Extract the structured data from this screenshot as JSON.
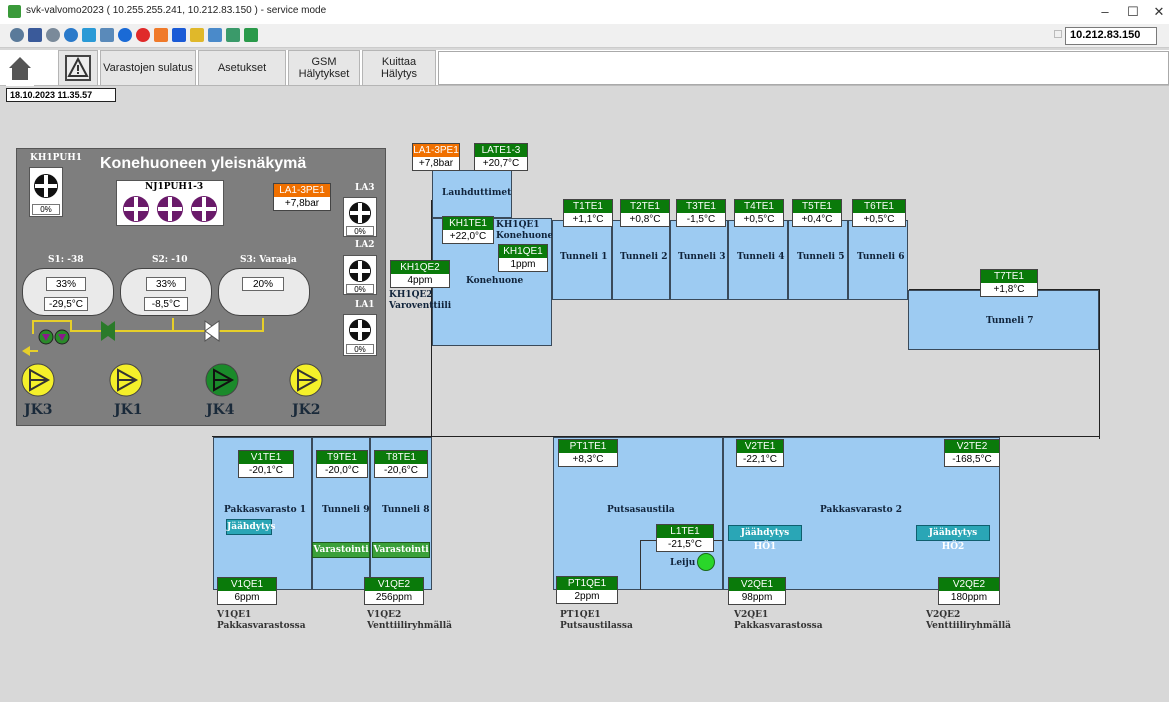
{
  "window": {
    "title": "svk-valvomo2023 ( 10.255.255.241, 10.212.83.150 ) - service mode",
    "ip": "10.212.83.150"
  },
  "nav": {
    "home_icon": "home-icon",
    "alarm_icon": "warning-icon",
    "btn1": "Varastojen sulatus",
    "btn2": "Asetukset",
    "btn3_l1": "GSM",
    "btn3_l2": "Hälytykset",
    "btn4_l1": "Kuittaa",
    "btn4_l2": "Hälytys"
  },
  "datetime": "18.10.2023 11.35.57",
  "machine": {
    "title": "Konehuoneen yleisnäkymä",
    "kh1puh1": "KH1PUH1",
    "kh1puh1_pct": "0%",
    "nj1puh": "NJ1PUH1-3",
    "la1_3pe1_tag": "LA1-3PE1",
    "la1_3pe1_val": "+7,8bar",
    "la3": "LA3",
    "la3_pct": "0%",
    "la2": "LA2",
    "la2_pct": "0%",
    "la1": "LA1",
    "la1_pct": "0%",
    "s1_label": "S1: -38",
    "s2_label": "S2: -10",
    "s3_label": "S3: Varaaja",
    "s1_pct": "33%",
    "s1_temp": "-29,5°C",
    "s2_pct": "33%",
    "s2_temp": "-8,5°C",
    "s3_pct": "20%",
    "jk3": "JK3",
    "jk1": "JK1",
    "jk4": "JK4",
    "jk2": "JK2"
  },
  "tags": {
    "la13pe1": {
      "name": "LA1-3PE1",
      "value": "+7,8bar"
    },
    "late13": {
      "name": "LATE1-3",
      "value": "+20,7°C"
    },
    "kh1te1": {
      "name": "KH1TE1",
      "value": "+22,0°C"
    },
    "kh1qe1": {
      "name": "KH1QE1",
      "value": "1ppm"
    },
    "kh1qe2": {
      "name": "KH1QE2",
      "value": "4ppm"
    },
    "t1te1": {
      "name": "T1TE1",
      "value": "+1,1°C"
    },
    "t2te1": {
      "name": "T2TE1",
      "value": "+0,8°C"
    },
    "t3te1": {
      "name": "T3TE1",
      "value": "-1,5°C"
    },
    "t4te1": {
      "name": "T4TE1",
      "value": "+0,5°C"
    },
    "t5te1": {
      "name": "T5TE1",
      "value": "+0,4°C"
    },
    "t6te1": {
      "name": "T6TE1",
      "value": "+0,5°C"
    },
    "t7te1": {
      "name": "T7TE1",
      "value": "+1,8°C"
    },
    "v1te1": {
      "name": "V1TE1",
      "value": "-20,1°C"
    },
    "t9te1": {
      "name": "T9TE1",
      "value": "-20,0°C"
    },
    "t8te1": {
      "name": "T8TE1",
      "value": "-20,6°C"
    },
    "pt1te1": {
      "name": "PT1TE1",
      "value": "+8,3°C"
    },
    "l1te1": {
      "name": "L1TE1",
      "value": "-21,5°C"
    },
    "v2te1": {
      "name": "V2TE1",
      "value": "-22,1°C"
    },
    "v2te2": {
      "name": "V2TE2",
      "value": "-168,5°C"
    },
    "v1qe1": {
      "name": "V1QE1",
      "value": "6ppm"
    },
    "v1qe2": {
      "name": "V1QE2",
      "value": "256ppm"
    },
    "pt1qe1": {
      "name": "PT1QE1",
      "value": "2ppm"
    },
    "v2qe1": {
      "name": "V2QE1",
      "value": "98ppm"
    },
    "v2qe2": {
      "name": "V2QE2",
      "value": "180ppm"
    }
  },
  "rooms": {
    "lauhduttimet": "Lauhduttimet",
    "konehuone": "Konehuone",
    "kh1qe1_l1": "KH1QE1",
    "kh1qe1_l2": "Konehuone",
    "kh1qe2_l1": "KH1QE2",
    "kh1qe2_l2": "Varoventtiili",
    "t1": "Tunneli 1",
    "t2": "Tunneli 2",
    "t3": "Tunneli 3",
    "t4": "Tunneli 4",
    "t5": "Tunneli 5",
    "t6": "Tunneli 6",
    "t7": "Tunneli 7",
    "pakkas1": "Pakkasvarasto 1",
    "t9": "Tunneli 9",
    "t8": "Tunneli 8",
    "putsaus": "Putsasaustila",
    "leiju": "Leiju",
    "pakkas2": "Pakkasvarasto 2",
    "jaahdytys": "Jäähdytys",
    "varastointi": "Varastointi",
    "jaahdytys_ho1": "Jäähdytys HÖ1",
    "jaahdytys_ho2": "Jäähdytys HÖ2"
  },
  "bottom": {
    "v1qe1_l1": "V1QE1",
    "v1qe1_l2": "Pakkasvarastossa",
    "v1qe2_l1": "V1QE2",
    "v1qe2_l2": "Venttiiliryhmällä",
    "pt1qe1_l1": "PT1QE1",
    "pt1qe1_l2": "Putsaustilassa",
    "v2qe1_l1": "V2QE1",
    "v2qe1_l2": "Pakkasvarastossa",
    "v2qe2_l1": "V2QE2",
    "v2qe2_l2": "Venttiiliryhmällä"
  }
}
